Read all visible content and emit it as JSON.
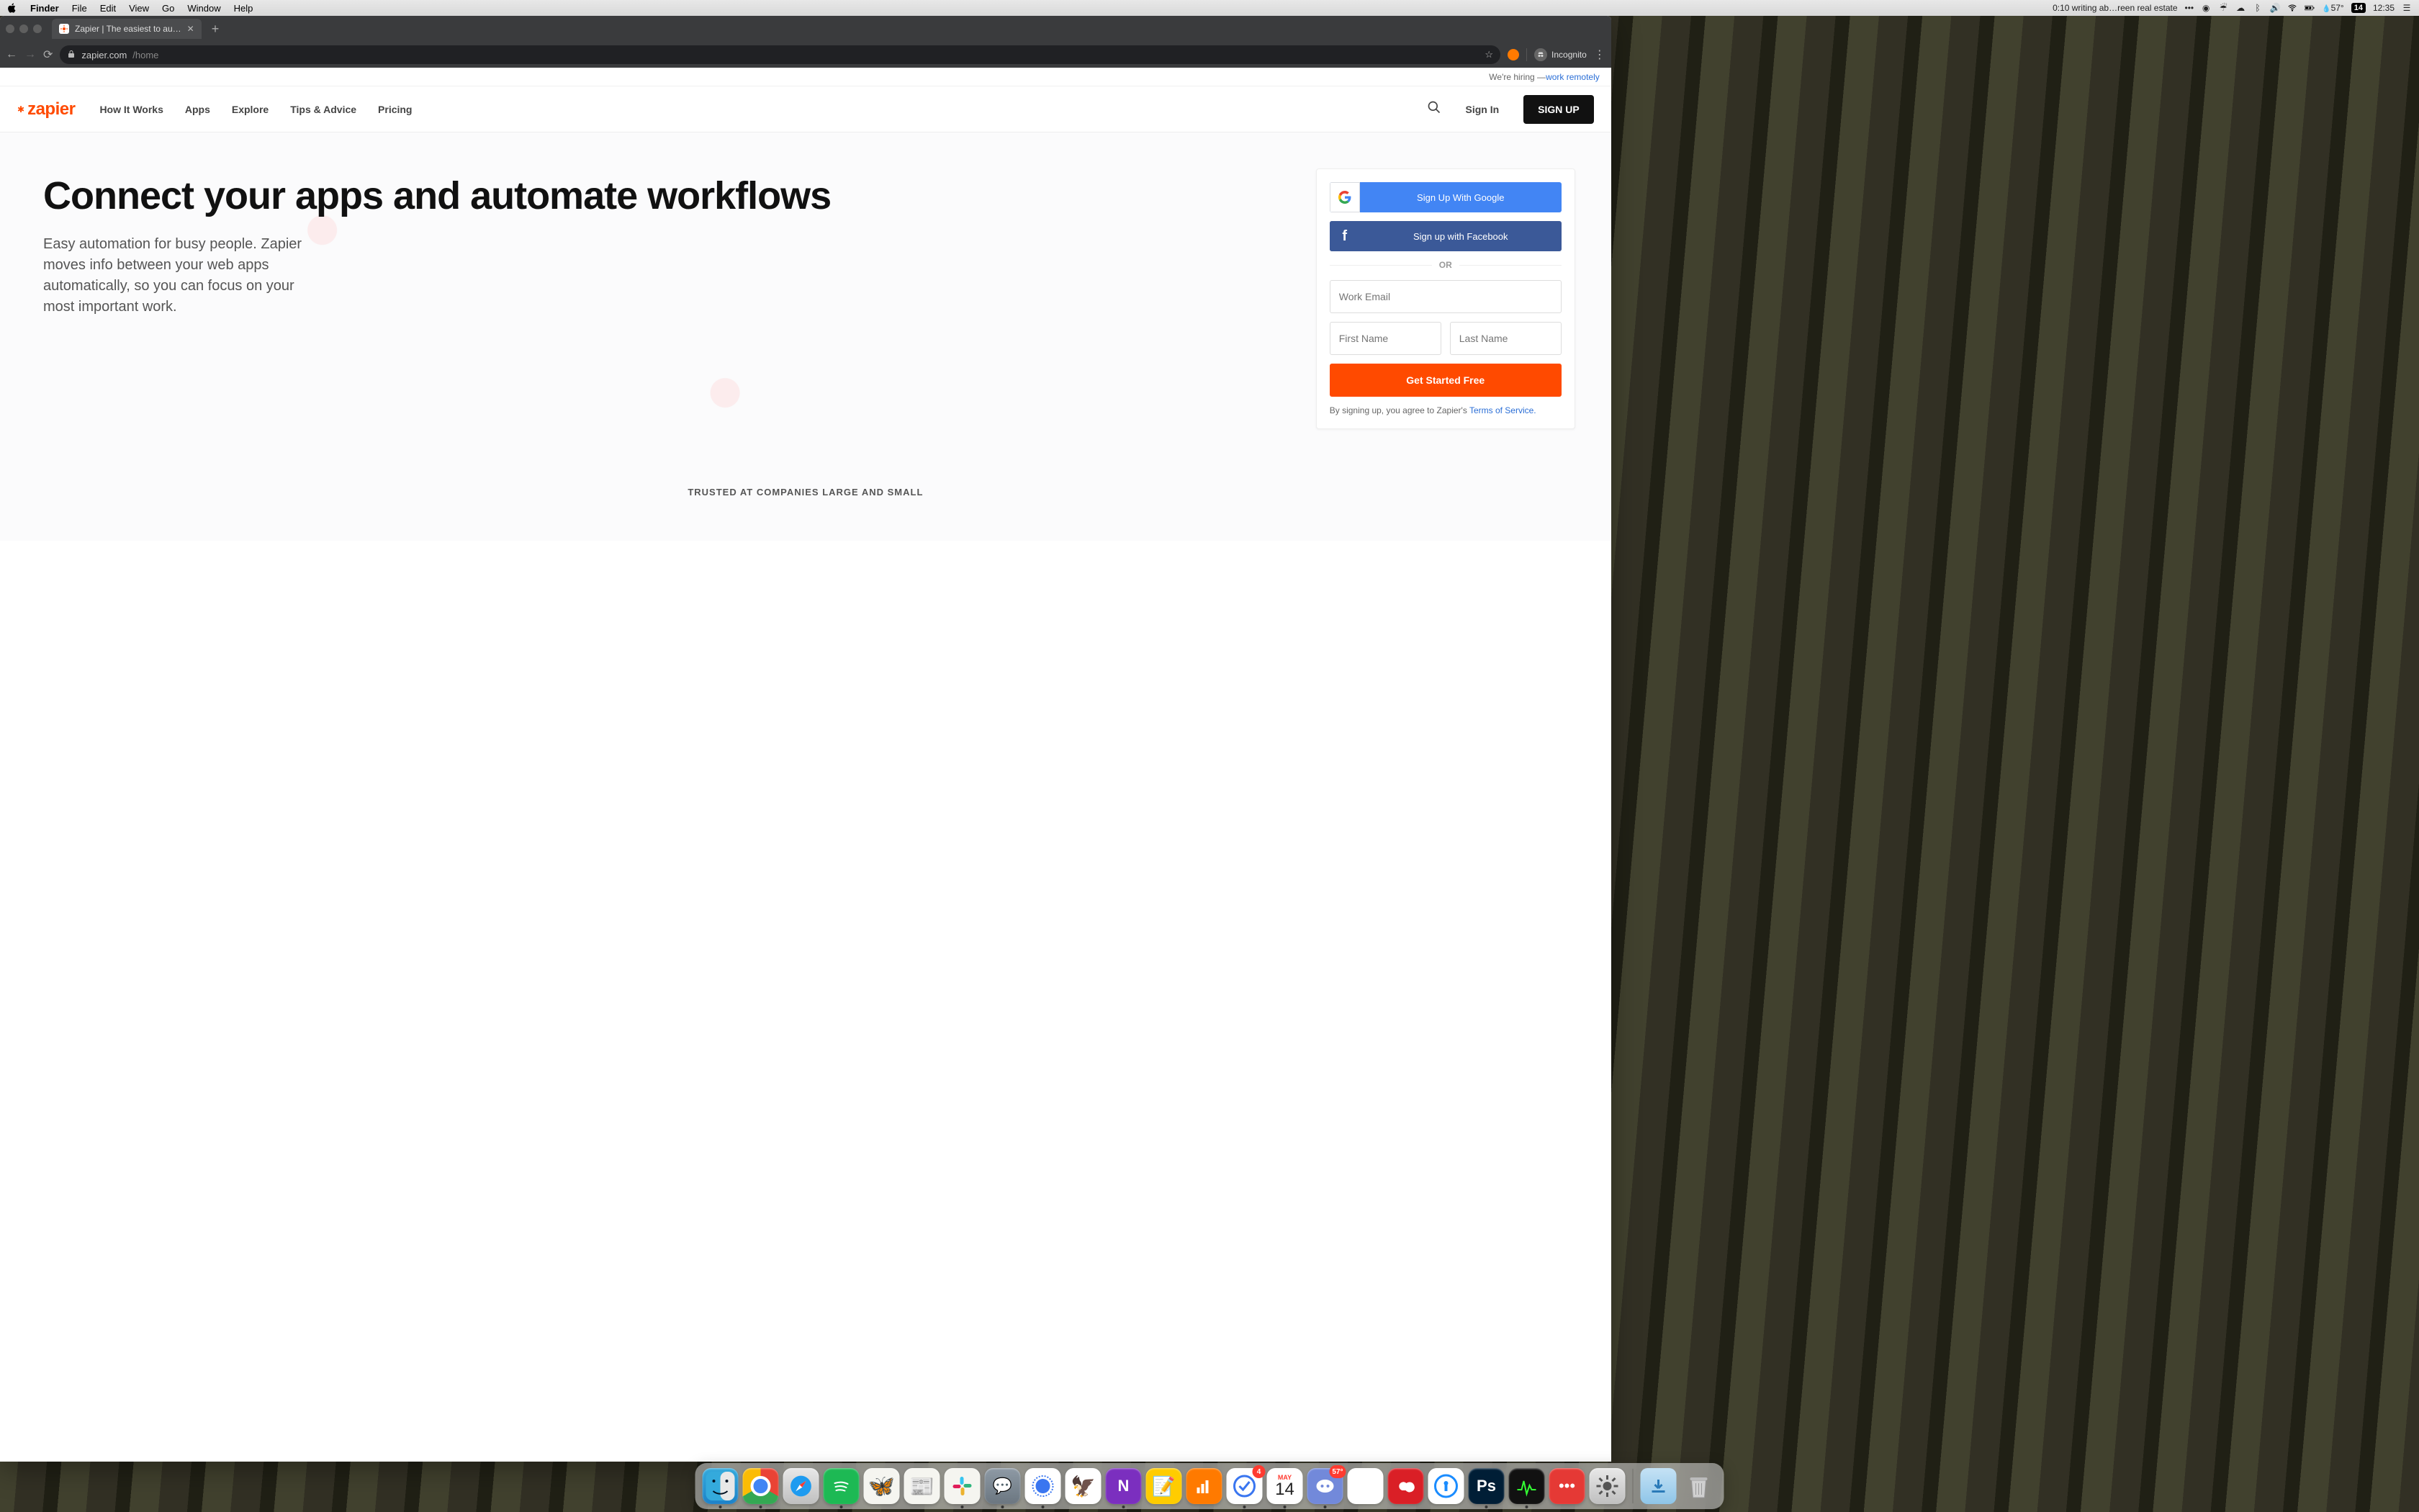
{
  "menubar": {
    "app": "Finder",
    "items": [
      "File",
      "Edit",
      "View",
      "Go",
      "Window",
      "Help"
    ],
    "status_text": "0:10 writing ab…reen real estate",
    "temp": "57°",
    "date_badge": "14",
    "clock": "12:35"
  },
  "browser": {
    "tab_title": "Zapier | The easiest to au…",
    "url_host": "zapier.com",
    "url_path": "/home",
    "incognito": "Incognito"
  },
  "hiring": {
    "prefix": "We're hiring — ",
    "link": "work remotely"
  },
  "nav": {
    "logo": "zapier",
    "links": [
      "How It Works",
      "Apps",
      "Explore",
      "Tips & Advice",
      "Pricing"
    ],
    "signin": "Sign In",
    "signup": "SIGN UP"
  },
  "hero": {
    "headline": "Connect your apps and automate workflows",
    "sub": "Easy automation for busy people. Zapier moves info between your web apps automatically, so you can focus on your most important work."
  },
  "signup": {
    "google": "Sign Up With Google",
    "facebook": "Sign up with Facebook",
    "or": "OR",
    "email_ph": "Work Email",
    "first_ph": "First Name",
    "last_ph": "Last Name",
    "cta": "Get Started Free",
    "legal_pre": "By signing up, you agree to Zapier's ",
    "legal_link": "Terms of Service."
  },
  "trusted": "TRUSTED AT COMPANIES LARGE AND SMALL",
  "dock": {
    "cal_month": "MAY",
    "cal_day": "14",
    "badge_things": "4",
    "badge_discord": "57°",
    "ps": "Ps"
  }
}
